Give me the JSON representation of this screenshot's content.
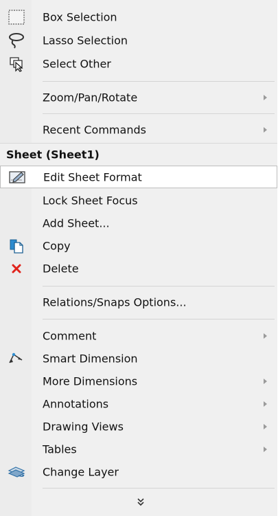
{
  "menu": {
    "items_top": [
      {
        "label": "Box Selection",
        "icon": "box-selection-icon"
      },
      {
        "label": "Lasso Selection",
        "icon": "lasso-icon"
      },
      {
        "label": "Select Other",
        "icon": "select-other-icon"
      }
    ],
    "submenus_top": [
      {
        "label": "Zoom/Pan/Rotate"
      },
      {
        "label": "Recent Commands"
      }
    ],
    "section_header": "Sheet (Sheet1)",
    "sheet_items": [
      {
        "label": "Edit Sheet Format",
        "icon": "edit-sheet-format-icon",
        "highlighted": true
      },
      {
        "label": "Lock Sheet Focus"
      },
      {
        "label": "Add Sheet..."
      },
      {
        "label": "Copy",
        "icon": "copy-icon"
      },
      {
        "label": "Delete",
        "icon": "delete-icon"
      }
    ],
    "relations_item": {
      "label": "Relations/Snaps Options..."
    },
    "bottom_items": [
      {
        "label": "Comment",
        "submenu": true
      },
      {
        "label": "Smart Dimension",
        "icon": "smart-dimension-icon"
      },
      {
        "label": "More Dimensions",
        "submenu": true
      },
      {
        "label": "Annotations",
        "submenu": true
      },
      {
        "label": "Drawing Views",
        "submenu": true
      },
      {
        "label": "Tables",
        "submenu": true
      },
      {
        "label": "Change Layer",
        "icon": "change-layer-icon"
      }
    ],
    "more_icon": "double-chevron-down-icon",
    "colors": {
      "highlight_bg": "#ffffff",
      "menu_bg": "#f0f0f0",
      "delete_red": "#e0231c"
    }
  }
}
